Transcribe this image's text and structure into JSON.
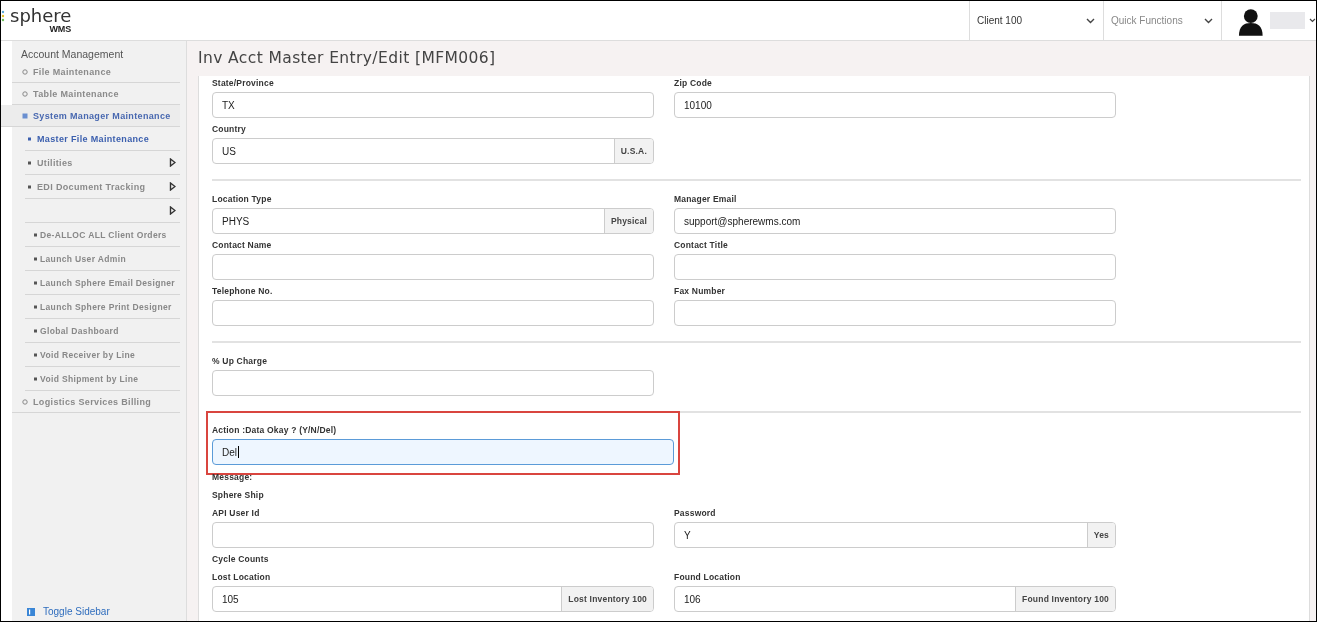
{
  "header": {
    "logo": {
      "name": "sphere",
      "suffix": "WMS"
    },
    "client_select": {
      "value": "Client 100"
    },
    "quick_functions": {
      "placeholder": "Quick Functions"
    }
  },
  "sidebar": {
    "heading": "Account Management",
    "items": [
      {
        "label": "File Maintenance",
        "kind": "group",
        "selected": false
      },
      {
        "label": "Table Maintenance",
        "kind": "group",
        "selected": false
      },
      {
        "label": "System Manager Maintenance",
        "kind": "group",
        "selected": true,
        "children": [
          {
            "label": "Master File Maintenance",
            "kind": "link",
            "selected": true
          },
          {
            "label": "Utilities",
            "kind": "submenu",
            "selected": false
          },
          {
            "label": "EDI Document Tracking",
            "kind": "submenu",
            "selected": false
          },
          {
            "kind": "submenu",
            "selected": false,
            "children": [
              {
                "label": "De-ALLOC ALL Client Orders",
                "kind": "link",
                "selected": false
              },
              {
                "label": "Launch User Admin",
                "kind": "link",
                "selected": false
              },
              {
                "label": "Launch Sphere Email Designer",
                "kind": "link",
                "selected": false
              },
              {
                "label": "Launch Sphere Print Designer",
                "kind": "link",
                "selected": false
              },
              {
                "label": "Global Dashboard",
                "kind": "link",
                "selected": false
              },
              {
                "label": "Void Receiver by Line",
                "kind": "link",
                "selected": false
              },
              {
                "label": "Void Shipment by Line",
                "kind": "link",
                "selected": false
              }
            ]
          }
        ]
      },
      {
        "label": "Logistics Services Billing",
        "kind": "group",
        "selected": false
      }
    ],
    "toggle": "Toggle Sidebar"
  },
  "page": {
    "title": "Inv Acct Master Entry/Edit [MFM006]",
    "sections": [
      {
        "rows": [
          {
            "kind": "fields",
            "cells": [
              {
                "label": "State/Province",
                "value": "TX",
                "focused": false,
                "highlighted": false
              },
              {
                "label": "Zip Code",
                "value": "10100",
                "focused": false,
                "highlighted": false
              }
            ]
          },
          {
            "kind": "fields",
            "cells": [
              {
                "label": "Country",
                "value": "US",
                "addon": "U.S.A.",
                "focused": false,
                "highlighted": false
              }
            ]
          }
        ]
      },
      {
        "rows": [
          {
            "kind": "fields",
            "cells": [
              {
                "label": "Location Type",
                "value": "PHYS",
                "addon": "Physical",
                "focused": false,
                "highlighted": false
              },
              {
                "label": "Manager Email",
                "value": "support@spherewms.com",
                "focused": false,
                "highlighted": false
              }
            ]
          },
          {
            "kind": "fields",
            "cells": [
              {
                "label": "Contact Name",
                "focused": false,
                "highlighted": false
              },
              {
                "label": "Contact Title",
                "focused": false,
                "highlighted": false
              }
            ]
          },
          {
            "kind": "fields",
            "cells": [
              {
                "label": "Telephone No.",
                "focused": false,
                "highlighted": false
              },
              {
                "label": "Fax Number",
                "focused": false,
                "highlighted": false
              }
            ]
          }
        ]
      },
      {
        "rows": [
          {
            "kind": "fields",
            "cells": [
              {
                "label": "% Up Charge",
                "focused": false,
                "highlighted": false
              }
            ]
          }
        ]
      },
      {
        "rows": [
          {
            "kind": "fields",
            "cells": [
              {
                "label": "Action :Data Okay ? (Y/N/Del)",
                "value": "Del",
                "focused": true,
                "highlighted": true
              }
            ]
          },
          {
            "kind": "note",
            "text": "Message:"
          },
          {
            "kind": "note",
            "text": "Sphere Ship"
          },
          {
            "kind": "fields",
            "cells": [
              {
                "label": "API User Id",
                "focused": false,
                "highlighted": false
              },
              {
                "label": "Password",
                "value": "Y",
                "addon": "Yes",
                "focused": false,
                "highlighted": false
              }
            ]
          },
          {
            "kind": "note",
            "text": "Cycle Counts"
          },
          {
            "kind": "fields",
            "cells": [
              {
                "label": "Lost Location",
                "value": "105",
                "addon": "Lost Inventory 100",
                "focused": false,
                "highlighted": false
              },
              {
                "label": "Found Location",
                "value": "106",
                "addon": "Found Inventory 100",
                "focused": false,
                "highlighted": false
              }
            ]
          }
        ]
      }
    ]
  }
}
